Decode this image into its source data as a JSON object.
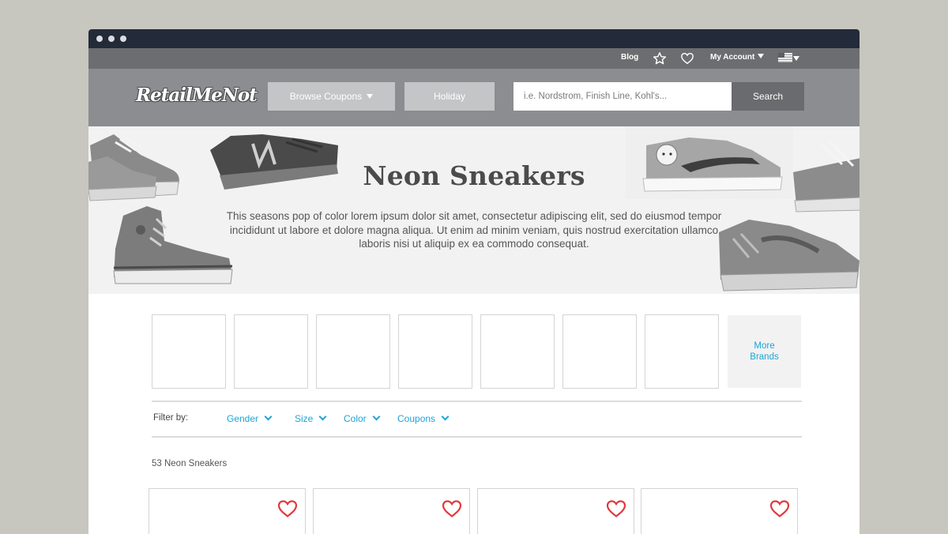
{
  "utility_bar": {
    "blog_label": "Blog",
    "account_label": "My Account"
  },
  "header": {
    "logo_text": "RetailMeNot",
    "browse_label": "Browse Coupons",
    "holiday_label": "Holiday",
    "search_placeholder": "i.e. Nordstrom, Finish Line, Kohl's...",
    "search_button": "Search"
  },
  "hero": {
    "title": "Neon Sneakers",
    "description": "This seasons pop of color lorem ipsum dolor sit amet, consectetur adipiscing elit, sed do eiusmod tempor incididunt ut labore et dolore magna aliqua. Ut enim ad minim veniam, quis nostrud exercitation ullamco laboris nisi ut aliquip ex ea commodo consequat."
  },
  "brands": {
    "more_label": "More Brands"
  },
  "filters": {
    "label": "Filter by:",
    "items": [
      "Gender",
      "Size",
      "Color",
      "Coupons"
    ]
  },
  "results": {
    "count_text": "53 Neon Sneakers"
  },
  "colors": {
    "accent_blue": "#1ea4d6",
    "heart_red": "#e0393e",
    "titlebar": "#232a39"
  }
}
